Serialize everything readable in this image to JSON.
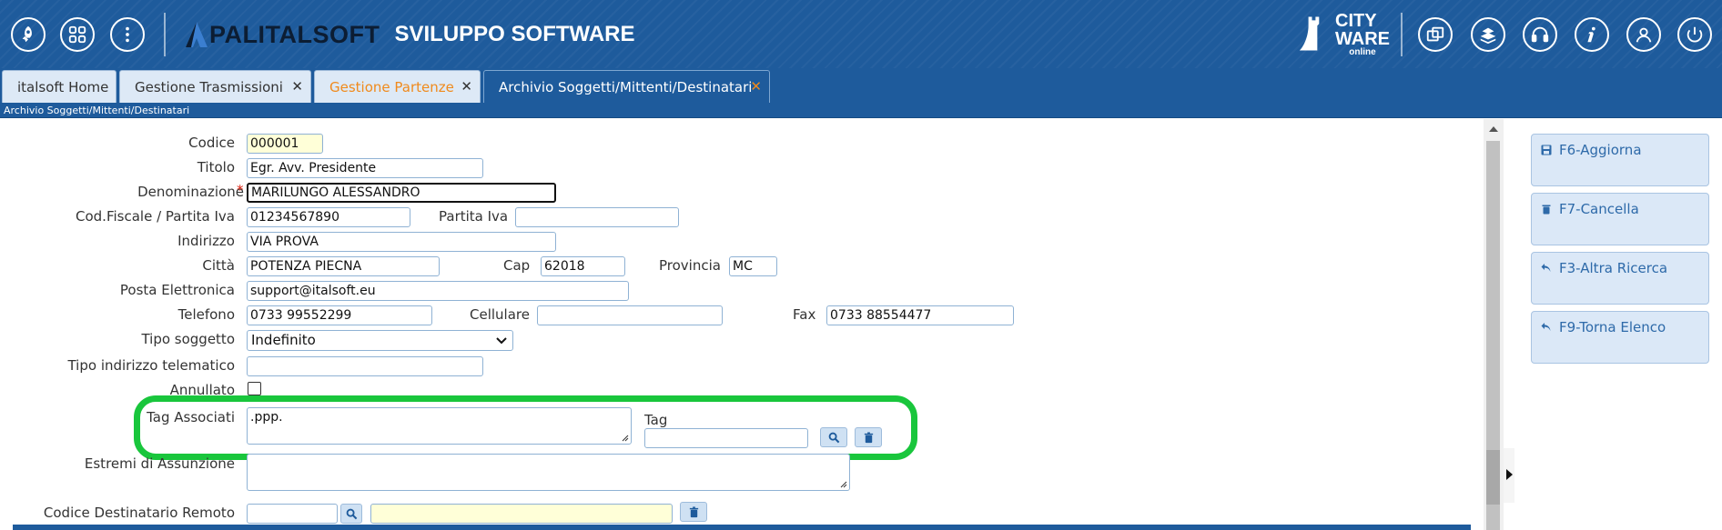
{
  "header": {
    "brand_name": "PALITALSOFT",
    "brand_subtitle": "SVILUPPO SOFTWARE",
    "cityware_line1": "CITY",
    "cityware_line2": "WARE",
    "cityware_line3": "online",
    "icons_left": [
      "rocket-icon",
      "grid-icon",
      "more-vertical-icon"
    ],
    "icons_right": [
      "windows-icon",
      "books-icon",
      "headset-icon",
      "info-icon",
      "user-icon",
      "power-icon"
    ],
    "color": "#1e5b9c"
  },
  "tabs": [
    {
      "label": "italsoft Home",
      "closable": false
    },
    {
      "label": "Gestione Trasmissioni",
      "close": "✕"
    },
    {
      "label": "Gestione Partenze",
      "close": "✕"
    },
    {
      "label": "Archivio Soggetti/Mittenti/Destinatari",
      "close": "✕"
    }
  ],
  "breadcrumb": "Archivio Soggetti/Mittenti/Destinatari",
  "form": {
    "codice": {
      "label": "Codice",
      "value": "000001"
    },
    "titolo": {
      "label": "Titolo",
      "value": "Egr. Avv. Presidente"
    },
    "denominazione": {
      "label": "Denominazione",
      "required": "*",
      "value": "MARILUNGO ALESSANDRO"
    },
    "cod_fiscale": {
      "label": "Cod.Fiscale / Partita Iva",
      "value": "01234567890"
    },
    "partita_iva": {
      "label": "Partita Iva",
      "value": ""
    },
    "indirizzo": {
      "label": "Indirizzo",
      "value": "VIA PROVA"
    },
    "citta": {
      "label": "Città",
      "value": "POTENZA PIECNA"
    },
    "cap": {
      "label": "Cap",
      "value": "62018"
    },
    "provincia": {
      "label": "Provincia",
      "value": "MC"
    },
    "posta": {
      "label": "Posta Elettronica",
      "value": "support@italsoft.eu"
    },
    "telefono": {
      "label": "Telefono",
      "value": "0733 99552299"
    },
    "cellulare": {
      "label": "Cellulare",
      "value": ""
    },
    "fax": {
      "label": "Fax",
      "value": "0733 88554477"
    },
    "tipo_soggetto": {
      "label": "Tipo soggetto",
      "value": "Indefinito"
    },
    "tipo_indirizzo": {
      "label": "Tipo indirizzo telematico",
      "value": ""
    },
    "annullato": {
      "label": "Annullato",
      "checked": false
    },
    "tag_associati": {
      "label": "Tag Associati",
      "value": ".ppp."
    },
    "tag": {
      "label": "Tag",
      "value": ""
    },
    "estremi": {
      "label": "Estremi di Assunzione",
      "value": ""
    },
    "codice_destinatario": {
      "label": "Codice Destinatario Remoto",
      "value": "",
      "value2": ""
    }
  },
  "actions": [
    {
      "label": "F6-Aggiorna",
      "icon": "save-icon"
    },
    {
      "label": "F7-Cancella",
      "icon": "trash-icon"
    },
    {
      "label": "F3-Altra Ricerca",
      "icon": "undo-icon"
    },
    {
      "label": "F9-Torna Elenco",
      "icon": "undo-icon"
    }
  ],
  "colors": {
    "highlight": "#19c63c",
    "accent_orange": "#f08a1c",
    "panel_button": "#dbe8f7"
  }
}
